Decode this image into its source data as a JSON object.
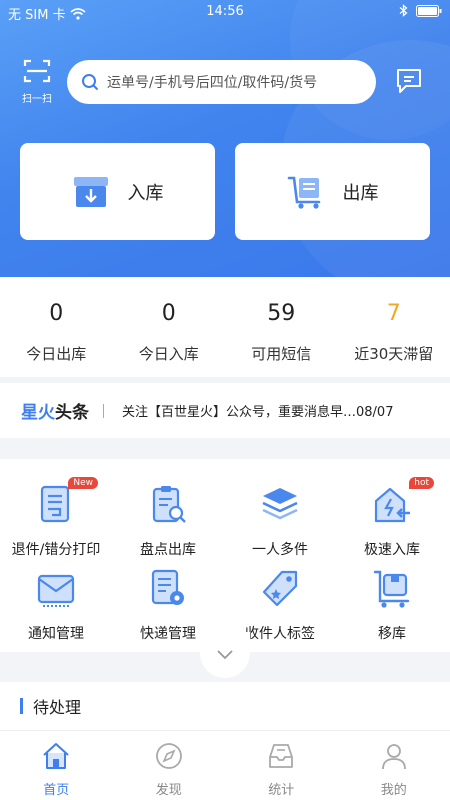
{
  "status_bar": {
    "carrier": "无 SIM 卡",
    "time": "14:56"
  },
  "header": {
    "scan_label": "扫一扫",
    "search_placeholder": "运单号/手机号后四位/取件码/货号"
  },
  "actions": {
    "inbound": "入库",
    "outbound": "出库"
  },
  "stats": [
    {
      "value": "0",
      "label": "今日出库",
      "color": "#222222"
    },
    {
      "value": "0",
      "label": "今日入库",
      "color": "#222222"
    },
    {
      "value": "59",
      "label": "可用短信",
      "color": "#222222"
    },
    {
      "value": "7",
      "label": "近30天滞留",
      "color": "#f5a623"
    }
  ],
  "news": {
    "brand_a": "星火",
    "brand_b": "头条",
    "text": "关注【百世星火】公众号，重要消息早…08/07"
  },
  "features": [
    {
      "label": "退件/错分打印",
      "icon": "return-print-icon",
      "badge": "New"
    },
    {
      "label": "盘点出库",
      "icon": "inventory-search-icon",
      "badge": ""
    },
    {
      "label": "一人多件",
      "icon": "stack-icon",
      "badge": ""
    },
    {
      "label": "极速入库",
      "icon": "fast-inbound-icon",
      "badge": "hot"
    },
    {
      "label": "通知管理",
      "icon": "envelope-icon",
      "badge": ""
    },
    {
      "label": "快递管理",
      "icon": "courier-settings-icon",
      "badge": ""
    },
    {
      "label": "收件人标签",
      "icon": "tag-icon",
      "badge": ""
    },
    {
      "label": "移库",
      "icon": "cart-icon",
      "badge": ""
    }
  ],
  "pending": {
    "title": "待处理"
  },
  "tabs": [
    {
      "label": "首页",
      "active": true
    },
    {
      "label": "发现",
      "active": false
    },
    {
      "label": "统计",
      "active": false
    },
    {
      "label": "我的",
      "active": false
    }
  ],
  "colors": {
    "accent": "#3e7ef0",
    "hero": "#4184ee",
    "warning": "#f5a623",
    "badge": "#e8473c"
  }
}
